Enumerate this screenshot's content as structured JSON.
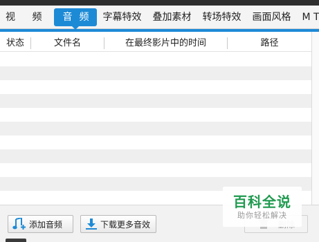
{
  "tabs": [
    {
      "label": "视 频",
      "active": false
    },
    {
      "label": "音频",
      "active": true
    },
    {
      "label": "字幕特效",
      "active": false
    },
    {
      "label": "叠加素材",
      "active": false
    },
    {
      "label": "转场特效",
      "active": false
    },
    {
      "label": "画面风格",
      "active": false
    },
    {
      "label": "M T",
      "active": false
    }
  ],
  "table": {
    "columns": [
      "状态",
      "文件名",
      "在最终影片中的时间",
      "路径"
    ],
    "rows": []
  },
  "buttons": {
    "add_audio": "添加音频",
    "download_more": "下载更多音效",
    "delete": "删除"
  },
  "icons": {
    "add_audio": "music-note-add-icon",
    "download_more": "download-arrow-icon",
    "delete": "trash-icon"
  },
  "watermark": {
    "title": "百科全说",
    "subtitle": "助你轻松解决"
  },
  "colors": {
    "accent": "#1d8ad6",
    "watermark_green": "#1f9a4f"
  }
}
